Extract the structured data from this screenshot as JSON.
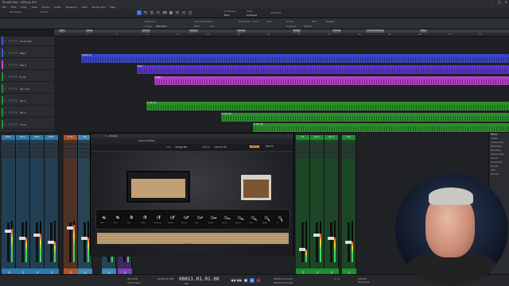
{
  "window": {
    "title": "Studio One - LEFtroy 5e*",
    "controls": [
      "–",
      "□",
      "✕"
    ]
  },
  "menu": [
    "File",
    "Edit",
    "Song",
    "Track",
    "Event",
    "Audio",
    "Transport",
    "View",
    "Studio One",
    "Help"
  ],
  "toolbar": {
    "tab_left_1": "Parameter",
    "tab_left_2": "Control",
    "tools": [
      "arrow-icon",
      "pencil-icon",
      "range-icon",
      "split-icon",
      "eraser-icon",
      "paint-icon",
      "mute-icon",
      "bend-icon",
      "listen-icon"
    ],
    "snap_label": "Snap",
    "quantize_label": "Quantize",
    "timebase_label": "Timebase",
    "timebase_value": "Bars",
    "snap_value": "Adaptive"
  },
  "infobar": {
    "selection_label": "Selection",
    "group_label": "Group",
    "group_value": "Standard",
    "sound_variation_label": "Sound Variation",
    "start_label": "Start",
    "end_label": "End",
    "transpose_label": "Transpose",
    "tune_label": "Tune",
    "gain_label": "Gain",
    "actions_label": "Action",
    "analysis_label": "Analysis",
    "detect_label": "Detect",
    "edit_label": "Edit",
    "repeat_label": "Repeat"
  },
  "ruler": {
    "ticks": [
      "1",
      "5",
      "9",
      "13",
      "17",
      "21",
      "25",
      "29",
      "33",
      "37",
      "41",
      "45",
      "49",
      "53",
      "57"
    ],
    "markers": [
      "Intro",
      "Verse",
      "Chorus",
      "Verse 2",
      "Chorus",
      "Bridge",
      "Chorus",
      "I Got The Feeling",
      "Outro"
    ]
  },
  "tracks": [
    {
      "num": "1",
      "name": "Drum VoA",
      "color": "#3b5bd6"
    },
    {
      "num": "2",
      "name": "Piano",
      "color": "#3b5bd6"
    },
    {
      "num": "3",
      "name": "Key 2",
      "color": "#c04fc9"
    },
    {
      "num": "4",
      "name": "E. Gt",
      "color": "#1c8f2e"
    },
    {
      "num": "5",
      "name": "Gtr. VoA",
      "color": "#1c8f2e"
    },
    {
      "num": "6",
      "name": "Gtr 2",
      "color": "#1c8f2e"
    },
    {
      "num": "7",
      "name": "Gtr 3",
      "color": "#1c8f2e"
    },
    {
      "num": "8",
      "name": "Vocal",
      "color": "#1c8f2e"
    }
  ],
  "clips": [
    {
      "name": "Guitar (4)",
      "color": "#3b45c4"
    },
    {
      "name": "Piano",
      "color": "#5a35c9"
    },
    {
      "name": "Organ",
      "color": "#b23fc1"
    },
    {
      "name": "E. Gtr (1)",
      "color": "#2a8f2a"
    },
    {
      "name": "E. Gtr (2)",
      "color": "#2a8f2a"
    },
    {
      "name": "E. Gtr (3)",
      "color": "#2a8f2a"
    }
  ],
  "plugin": {
    "title": "1 - Ampire",
    "preset": "Crunchy Plexi",
    "bar_items": [
      "Amp",
      "Vintage Brit",
      "Cabinet",
      "2x12 VC 30",
      "Stomp",
      "Post FX"
    ],
    "brand": "Ampire",
    "knob_labels": [
      "Gain",
      "Bass",
      "Mid",
      "Treble",
      "Presence",
      "Volume",
      "Reverb",
      "Tone",
      "Depth",
      "Speed",
      "Master",
      "Level",
      "Bright",
      "Cut"
    ]
  },
  "mixer": {
    "channels": [
      {
        "name": "Drum",
        "color": "#2c7ab1"
      },
      {
        "name": "Piano",
        "color": "#2c7ab1"
      },
      {
        "name": "Bass",
        "color": "#2c7ab1"
      },
      {
        "name": "Synth",
        "color": "#2c7ab1"
      },
      {
        "name": "E. Gt",
        "color": "#b0532a"
      },
      {
        "name": "Gtr",
        "color": "#3a8bb8"
      },
      {
        "name": "Key",
        "color": "#3a8bb8"
      },
      {
        "name": "Organ",
        "color": "#7d3fc2"
      },
      {
        "name": "FX",
        "color": "#1c8f2e"
      },
      {
        "name": "Gtr 2",
        "color": "#1c8f2e"
      },
      {
        "name": "Gtr 3",
        "color": "#1c8f2e"
      },
      {
        "name": "Vox",
        "color": "#1c8f2e"
      }
    ],
    "levels": [
      0.8,
      0.6,
      0.7,
      0.5,
      0.9,
      0.6,
      0.4,
      0.5,
      0.3,
      0.7,
      0.6,
      0.5
    ]
  },
  "browser": {
    "title": "Effects",
    "items": [
      "Ampire",
      "Analog Delay",
      "Beat Delay",
      "Bitcrusher",
      "Channel Strip",
      "Chorus",
      "Compressor",
      "Flanger",
      "Gate",
      "Mixverb"
    ]
  },
  "transport": {
    "sample_rate": "48.0 kHz",
    "record_max": "16.12 days",
    "time_display": "00:00:07.198",
    "timecode": "00011.01.01.00",
    "bars_label": "Bars",
    "start": "00001.01.01.00",
    "end": "00197.01.01.00",
    "tempo": "120.00",
    "signature": "4 / 4",
    "metronome": "Metronome"
  }
}
